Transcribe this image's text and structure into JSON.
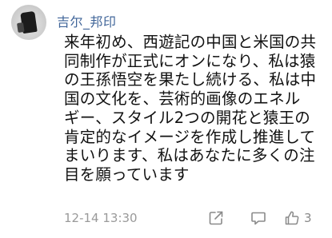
{
  "comment": {
    "username": "吉尔_邦印",
    "text_lines": [
      "来年初め、西遊記の中国と米国の共",
      "同制作が正式にオンになり、私は猿",
      "の王孫悟空を果たし続ける、私は中",
      "国の文化を、芸術的画像のエネル",
      "ギー、スタイル2つの開花と猿王の",
      "肯定的なイメージを作成し推進して",
      "まいります、私はあなたに多くの注",
      "目を願っています"
    ],
    "timestamp": "12-14 13:30",
    "like_count": "3"
  },
  "icons": {
    "avatar": "avatar",
    "share": "share-icon",
    "comment": "comment-icon",
    "like": "thumbs-up-icon"
  },
  "colors": {
    "username": "#406599",
    "text": "#111111",
    "meta": "#9a9a9a"
  }
}
